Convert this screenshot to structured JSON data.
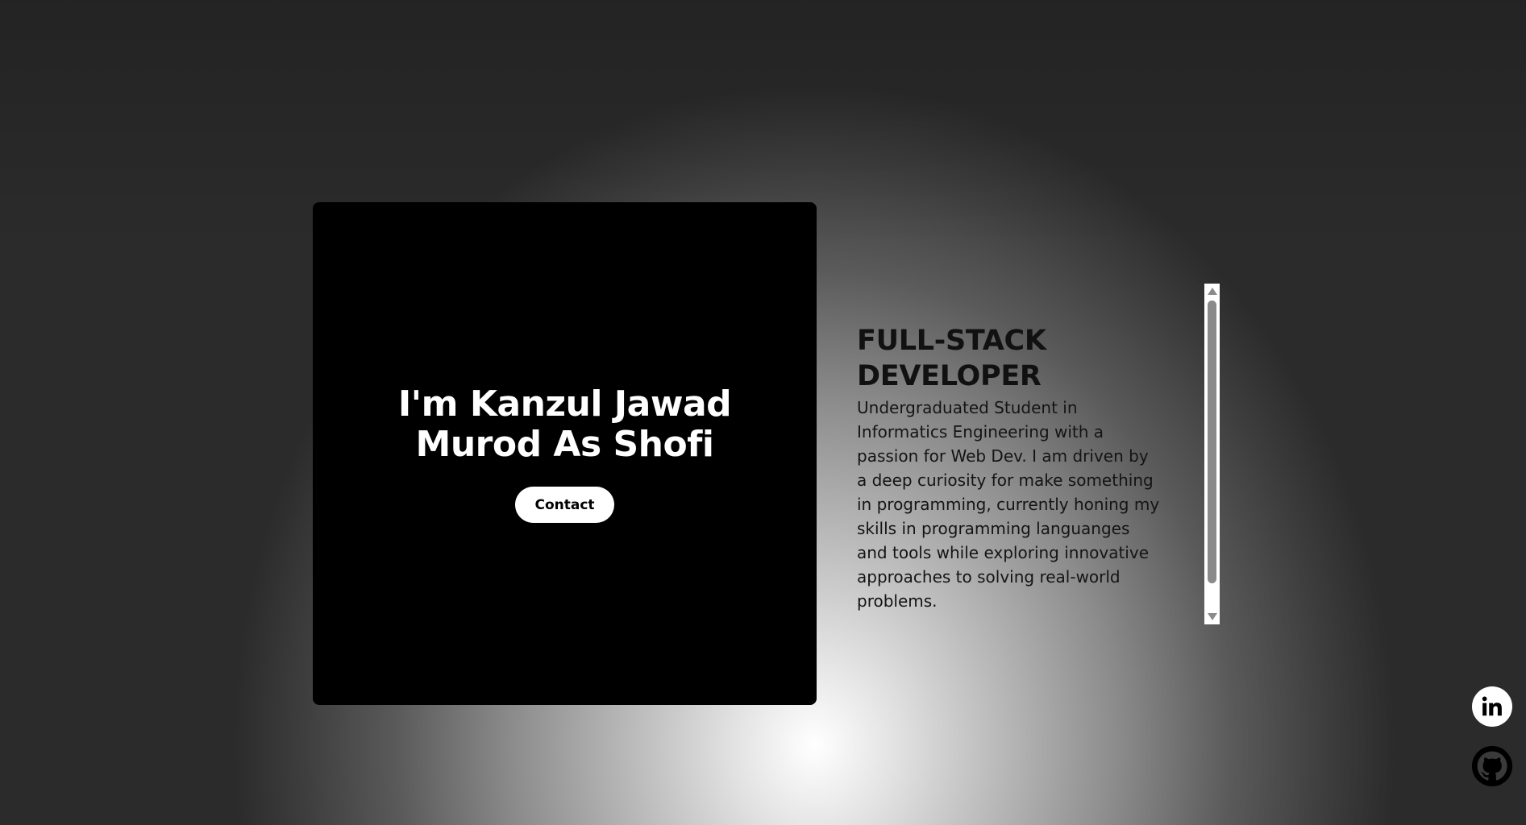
{
  "hero": {
    "title": "I'm Kanzul Jawad Murod As Shofi",
    "contact_label": "Contact"
  },
  "about": {
    "role": "FULL-STACK DEVELOPER",
    "description": "Undergraduated Student in Informatics Engineering with a passion for Web Dev. I am driven by a deep curiosity for make something in programming, currently honing my skills in programming languanges and tools while exploring innovative approaches to solving real-world problems."
  },
  "social": {
    "linkedin_icon": "linkedin-icon",
    "github_icon": "github-icon"
  },
  "colors": {
    "card_background": "#000000",
    "button_background": "#ffffff",
    "text_dark": "#111111"
  }
}
